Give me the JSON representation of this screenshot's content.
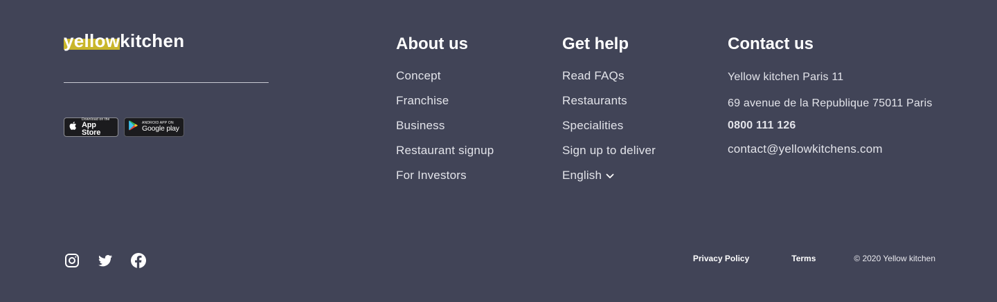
{
  "brand": {
    "logo_highlight": "yellow",
    "logo_rest": "kitchen",
    "highlight_color": "#c9b62b"
  },
  "app_badges": {
    "apple": {
      "small": "Download on the",
      "big": "App Store",
      "icon": "apple-icon"
    },
    "google": {
      "small": "ANDROID APP ON",
      "big": "Google play",
      "icon": "google-play-icon"
    }
  },
  "about": {
    "title": "About us",
    "items": [
      "Concept",
      "Franchise",
      "Business",
      "Restaurant signup",
      "For Investors"
    ]
  },
  "help": {
    "title": "Get help",
    "items": [
      "Read FAQs",
      "Restaurants",
      "Specialities",
      "Sign up to deliver"
    ],
    "language": "English"
  },
  "contact": {
    "title": "Contact us",
    "name": "Yellow kitchen Paris 11",
    "address": "69 avenue de la Republique 75011 Paris",
    "phone": "0800 111 126",
    "email": "contact@yellowkitchens.com"
  },
  "social": [
    "instagram-icon",
    "twitter-icon",
    "facebook-icon"
  ],
  "legal": {
    "privacy": "Privacy Policy",
    "terms": "Terms",
    "copyright": "© 2020 Yellow kitchen"
  },
  "colors": {
    "background": "#414457",
    "text": "#ffffff",
    "muted_text": "#e3e4ea"
  }
}
